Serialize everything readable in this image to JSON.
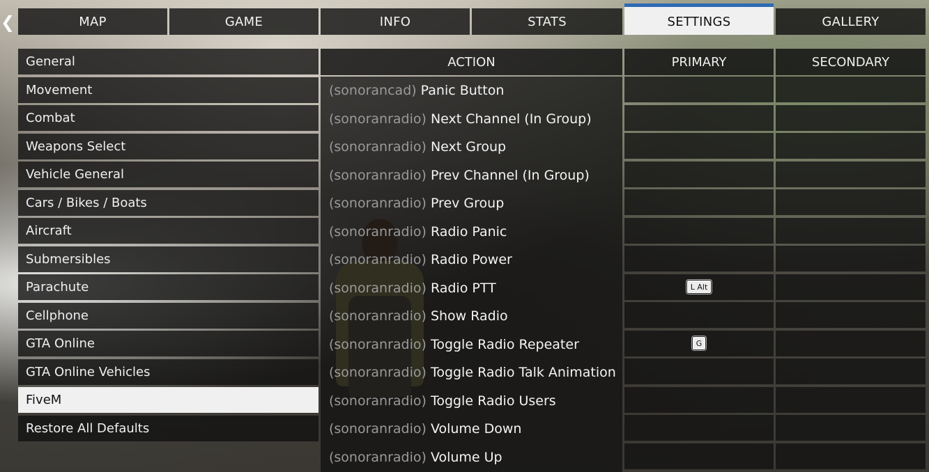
{
  "tabs": [
    {
      "label": "MAP"
    },
    {
      "label": "GAME"
    },
    {
      "label": "INFO"
    },
    {
      "label": "STATS"
    },
    {
      "label": "SETTINGS"
    },
    {
      "label": "GALLERY"
    }
  ],
  "categories": [
    {
      "label": "General"
    },
    {
      "label": "Movement"
    },
    {
      "label": "Combat"
    },
    {
      "label": "Weapons Select"
    },
    {
      "label": "Vehicle General"
    },
    {
      "label": "Cars / Bikes / Boats"
    },
    {
      "label": "Aircraft"
    },
    {
      "label": "Submersibles"
    },
    {
      "label": "Parachute"
    },
    {
      "label": "Cellphone"
    },
    {
      "label": "GTA Online"
    },
    {
      "label": "GTA Online Vehicles"
    },
    {
      "label": "FiveM"
    },
    {
      "label": "Restore All Defaults"
    }
  ],
  "columns": {
    "action": "ACTION",
    "primary": "PRIMARY",
    "secondary": "SECONDARY"
  },
  "rows": [
    {
      "prefix": "(sonorancad)",
      "action": "Panic Button",
      "primary": "",
      "secondary": ""
    },
    {
      "prefix": "(sonoranradio)",
      "action": "Next Channel (In Group)",
      "primary": "",
      "secondary": ""
    },
    {
      "prefix": "(sonoranradio)",
      "action": "Next Group",
      "primary": "",
      "secondary": ""
    },
    {
      "prefix": "(sonoranradio)",
      "action": "Prev Channel (In Group)",
      "primary": "",
      "secondary": ""
    },
    {
      "prefix": "(sonoranradio)",
      "action": "Prev Group",
      "primary": "",
      "secondary": ""
    },
    {
      "prefix": "(sonoranradio)",
      "action": "Radio Panic",
      "primary": "",
      "secondary": ""
    },
    {
      "prefix": "(sonoranradio)",
      "action": "Radio Power",
      "primary": "",
      "secondary": ""
    },
    {
      "prefix": "(sonoranradio)",
      "action": "Radio PTT",
      "primary": "L Alt",
      "secondary": ""
    },
    {
      "prefix": "(sonoranradio)",
      "action": "Show Radio",
      "primary": "",
      "secondary": ""
    },
    {
      "prefix": "(sonoranradio)",
      "action": "Toggle Radio Repeater",
      "primary": "G",
      "secondary": ""
    },
    {
      "prefix": "(sonoranradio)",
      "action": "Toggle Radio Talk Animation",
      "primary": "",
      "secondary": ""
    },
    {
      "prefix": "(sonoranradio)",
      "action": "Toggle Radio Users",
      "primary": "",
      "secondary": ""
    },
    {
      "prefix": "(sonoranradio)",
      "action": "Volume Down",
      "primary": "",
      "secondary": ""
    },
    {
      "prefix": "(sonoranradio)",
      "action": "Volume Up",
      "primary": "",
      "secondary": ""
    }
  ],
  "state": {
    "active_tab": "SETTINGS",
    "selected_category": "FiveM"
  },
  "colors": {
    "accent": "#2d6ab4",
    "selected_bg": "#f0f0f0",
    "panel_bg": "#121212"
  },
  "icons": {
    "back": "chevron-left-icon"
  }
}
